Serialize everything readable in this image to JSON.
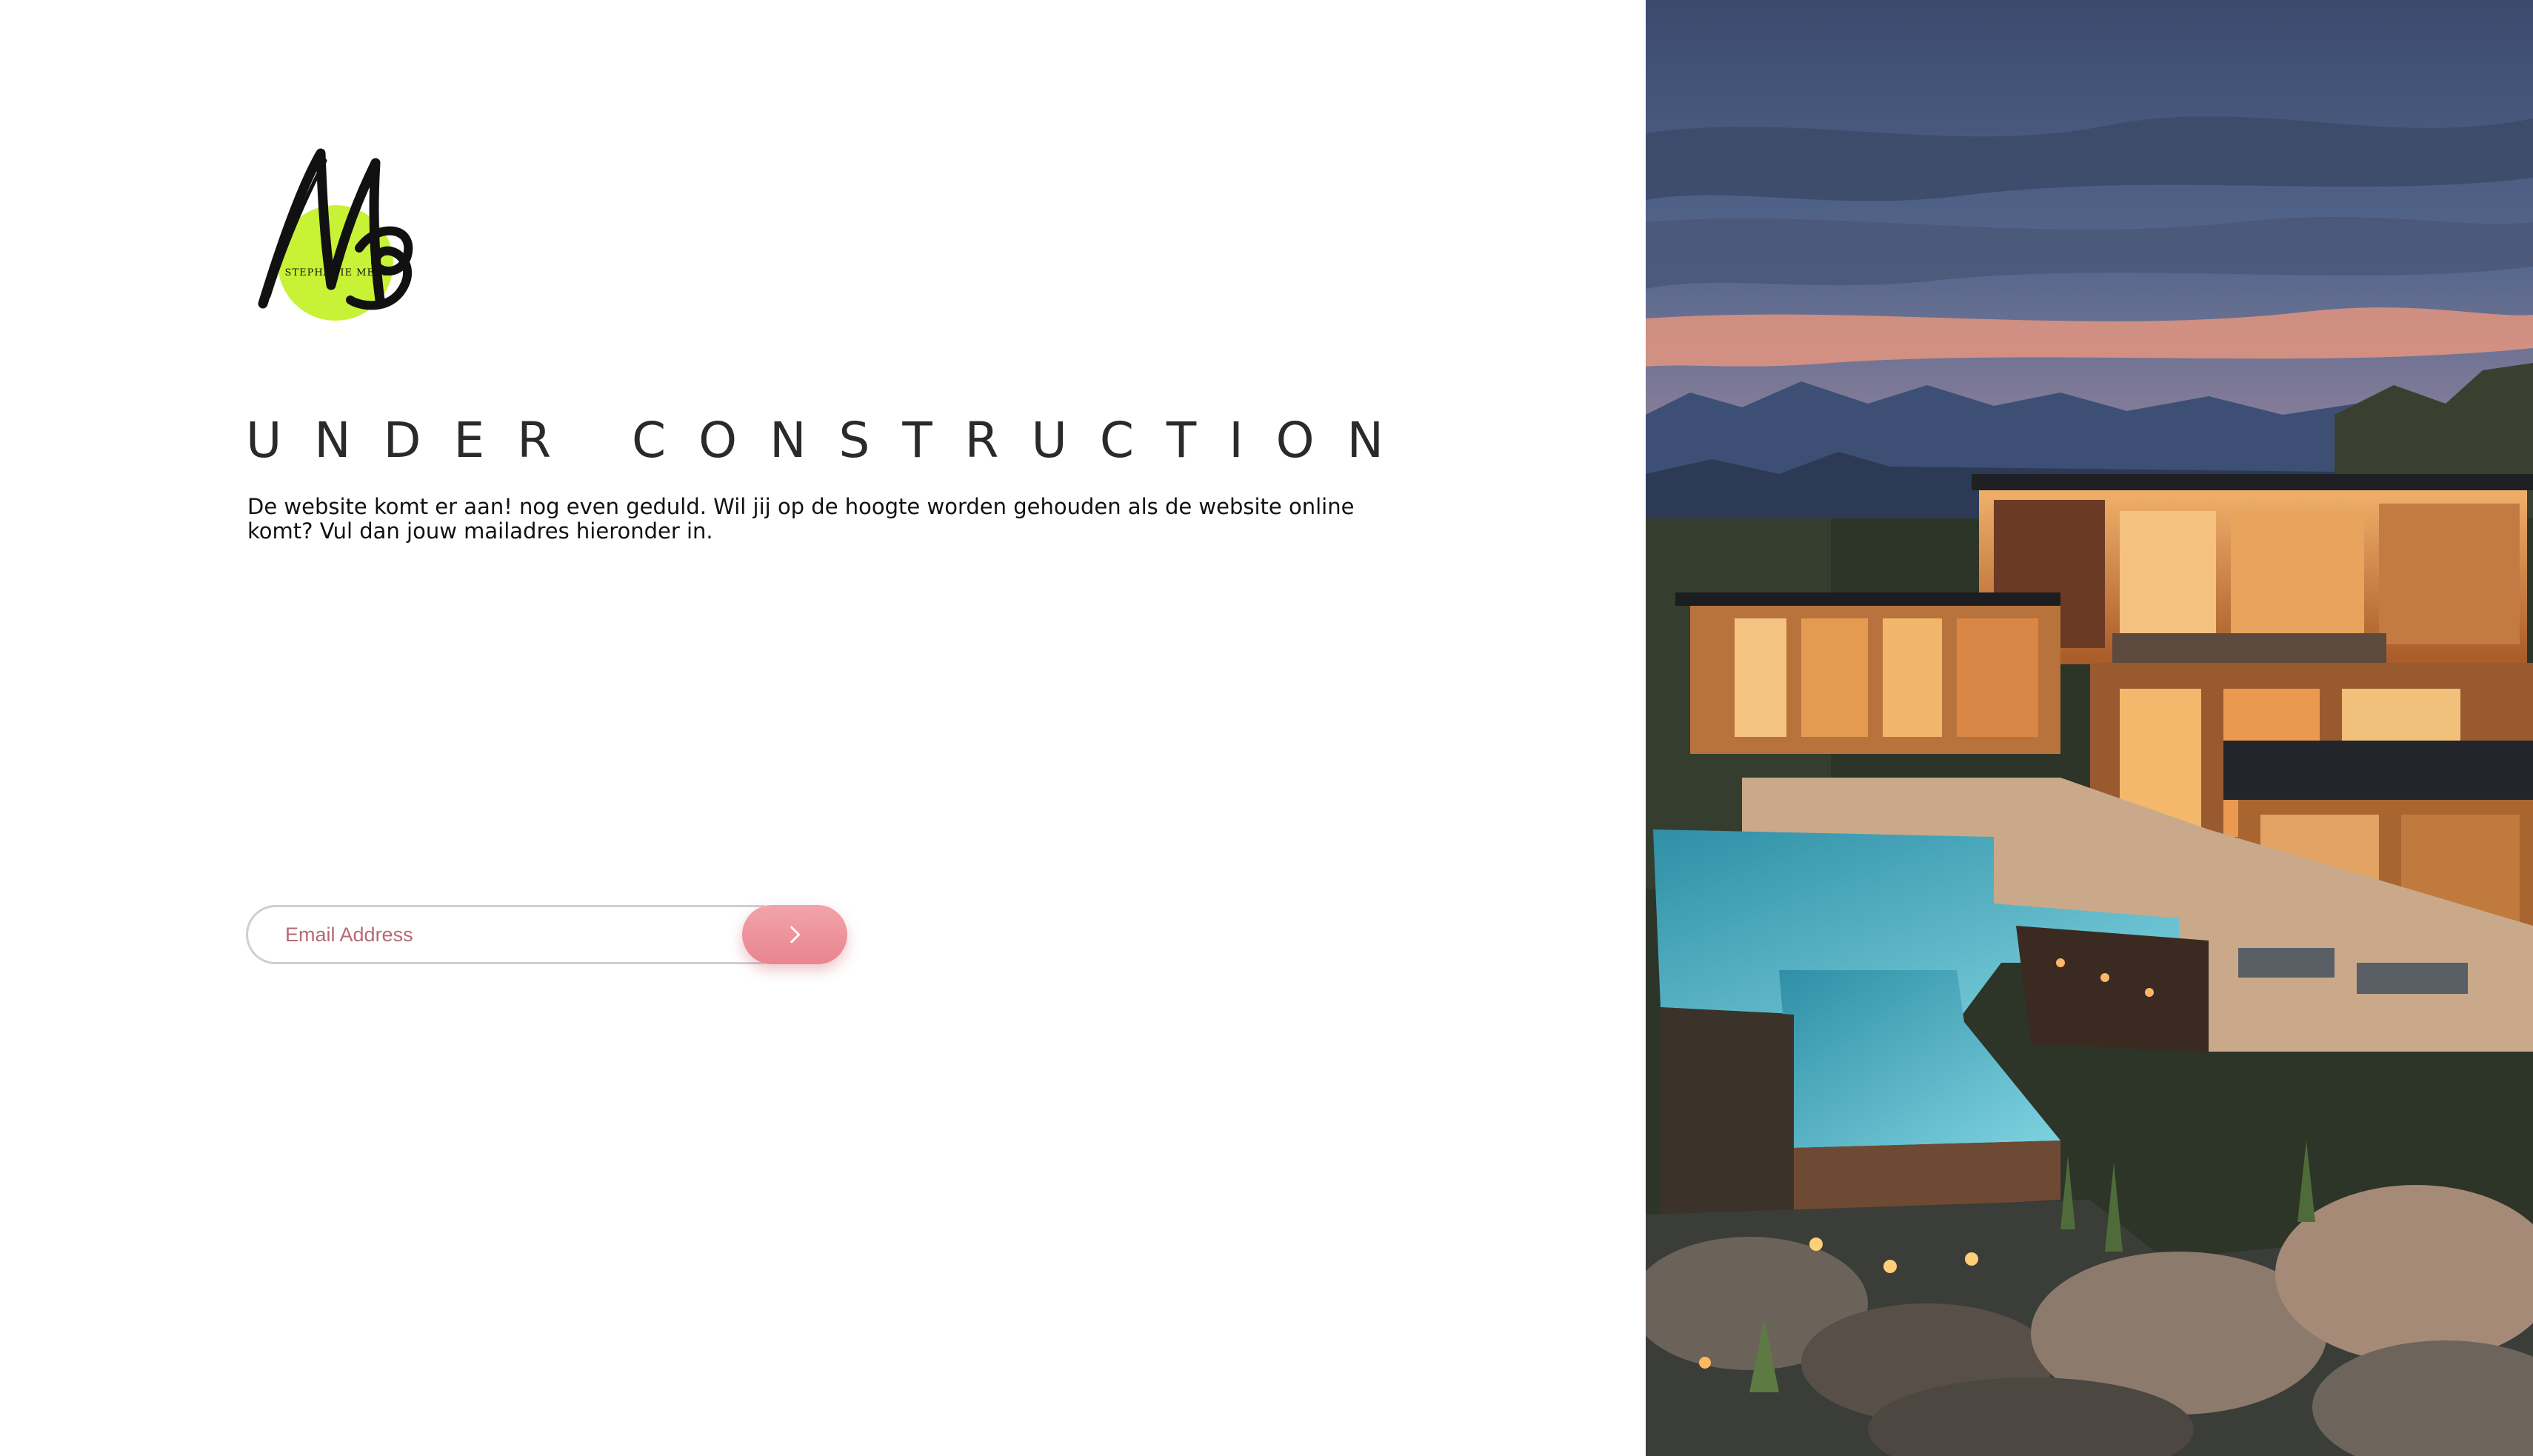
{
  "logo": {
    "text": "STEPHANIE MEYS",
    "icon": "signature-logo-icon",
    "accent_color": "#c8f236"
  },
  "hero": {
    "title": "UNDER CONSTRUCTION",
    "description": "De website komt er aan! nog even geduld. Wil jij op de hoogte worden gehouden als de website online komt? Vul dan jouw mailadres hieronder in."
  },
  "signup": {
    "email_placeholder": "Email Address",
    "submit_icon": "chevron-right-icon",
    "button_color": "#ee959d"
  },
  "image": {
    "subject": "modern desert house at dusk with pool"
  }
}
